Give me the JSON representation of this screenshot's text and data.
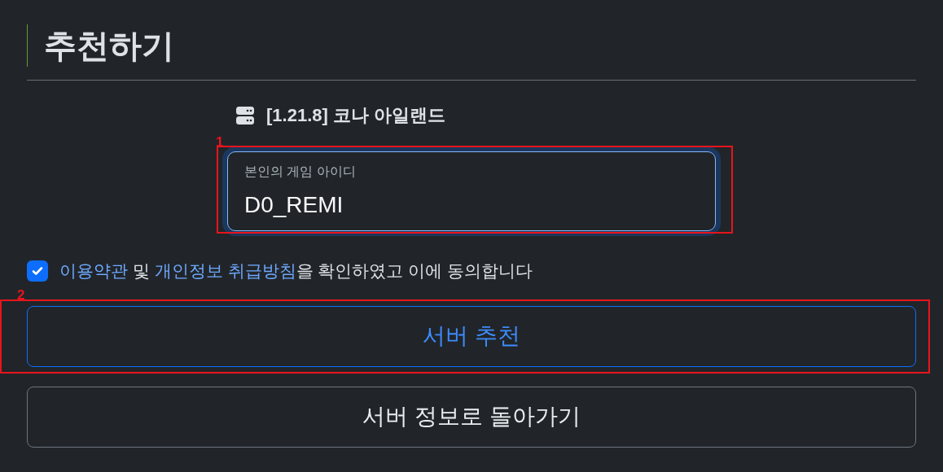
{
  "title": "추천하기",
  "server": {
    "name": "[1.21.8] 코나 아일랜드"
  },
  "field": {
    "label": "본인의 게임 아이디",
    "value": "D0_REMI",
    "annotation": "1"
  },
  "agreement": {
    "checked": true,
    "parts": [
      {
        "text": "이용약관",
        "link": true
      },
      {
        "text": " 및 ",
        "link": false
      },
      {
        "text": "개인정보 취급방침",
        "link": true
      },
      {
        "text": "을 확인하였고 이에 동의합니다",
        "link": false
      }
    ]
  },
  "buttons": [
    {
      "label": "서버 추천",
      "kind": "primary",
      "annotation": "2"
    },
    {
      "label": "서버 정보로 돌아가기",
      "kind": "secondary"
    }
  ]
}
